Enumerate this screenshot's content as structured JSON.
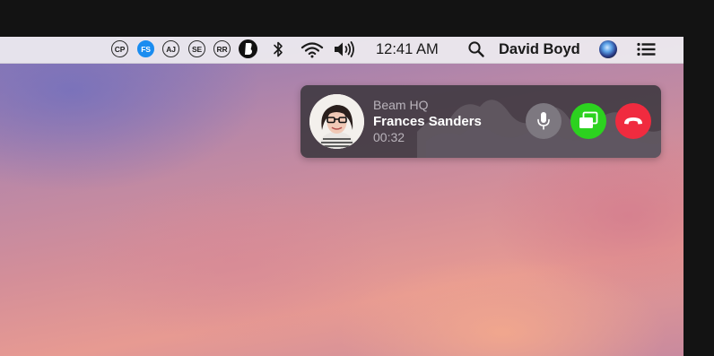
{
  "menubar": {
    "participants": [
      {
        "initials": "CP",
        "active": false
      },
      {
        "initials": "FS",
        "active": true
      },
      {
        "initials": "AJ",
        "active": false
      },
      {
        "initials": "SE",
        "active": false
      },
      {
        "initials": "RR",
        "active": false
      }
    ],
    "app_icon": "beam-app-icon",
    "status_icons": [
      "bluetooth-icon",
      "wifi-icon",
      "volume-icon"
    ],
    "time": "12:41 AM",
    "search_icon": "search-icon",
    "user_name": "David Boyd",
    "siri_icon": "siri-icon",
    "list_icon": "notification-center-icon"
  },
  "call": {
    "team": "Beam HQ",
    "caller_name": "Frances Sanders",
    "duration": "00:32",
    "buttons": {
      "mute_icon": "microphone-icon",
      "screen_icon": "screen-share-icon",
      "hangup_icon": "hang-up-icon"
    },
    "colors": {
      "mute": "#7d7880",
      "screen_share": "#2cd21f",
      "hang_up": "#f02b3f",
      "active_chip": "#1a8cf0"
    }
  }
}
